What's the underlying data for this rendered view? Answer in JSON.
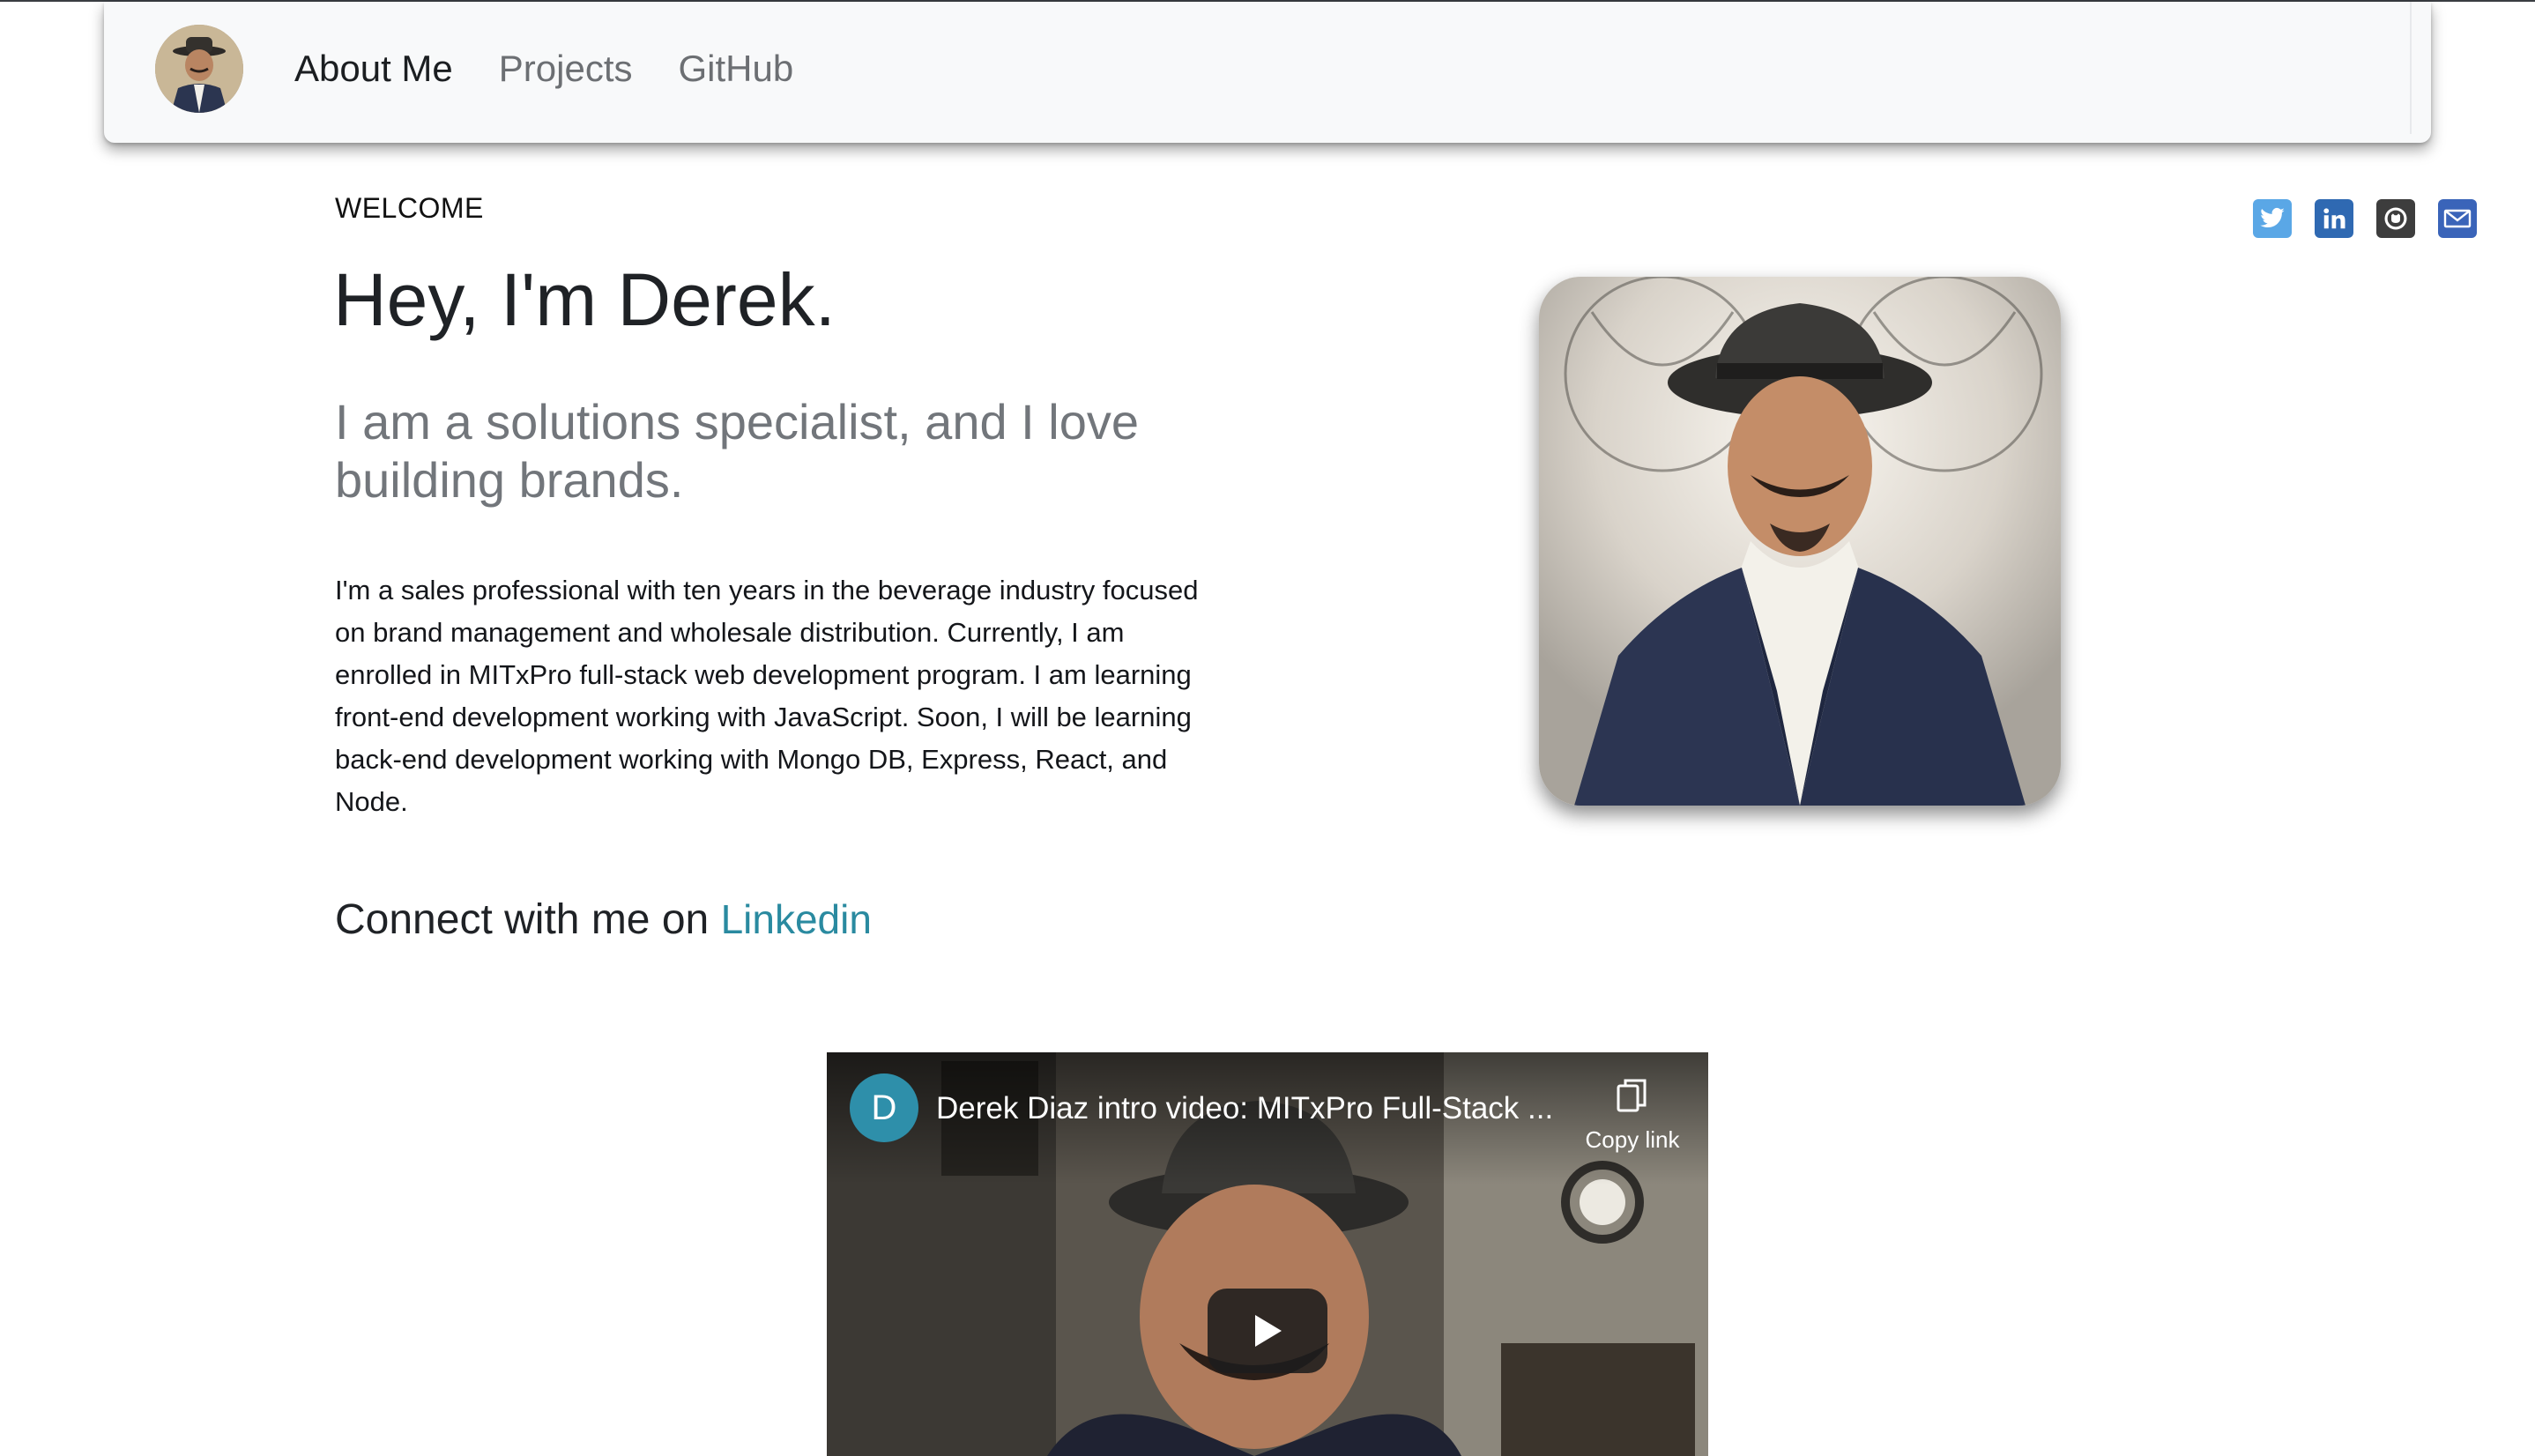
{
  "nav": {
    "avatar_alt": "Derek Diaz avatar",
    "links": [
      {
        "label": "About Me",
        "active": true
      },
      {
        "label": "Projects",
        "active": false
      },
      {
        "label": "GitHub",
        "active": false
      }
    ]
  },
  "social": {
    "icons": [
      "twitter-icon",
      "linkedin-icon",
      "github-icon",
      "email-icon"
    ]
  },
  "hero": {
    "eyebrow": "WELCOME",
    "title": "Hey, I'm Derek.",
    "subtitle": "I am a solutions specialist, and I love building brands.",
    "body": "I'm a sales professional with ten years in the beverage industry focused on brand management and wholesale distribution. Currently, I am enrolled in MITxPro full-stack web development program. I am learning front-end development working with JavaScript. Soon, I will be learning back-end development working with Mongo DB, Express, React, and Node.",
    "connect_prefix": "Connect with me on",
    "connect_link": "Linkedin"
  },
  "video": {
    "channel_initial": "D",
    "title": "Derek Diaz intro video: MITxPro Full-Stack ...",
    "copy_link_label": "Copy link"
  },
  "colors": {
    "link": "#2a8aa0",
    "navbar_bg": "#f8f9fa",
    "channel_badge": "#2e8faa"
  }
}
